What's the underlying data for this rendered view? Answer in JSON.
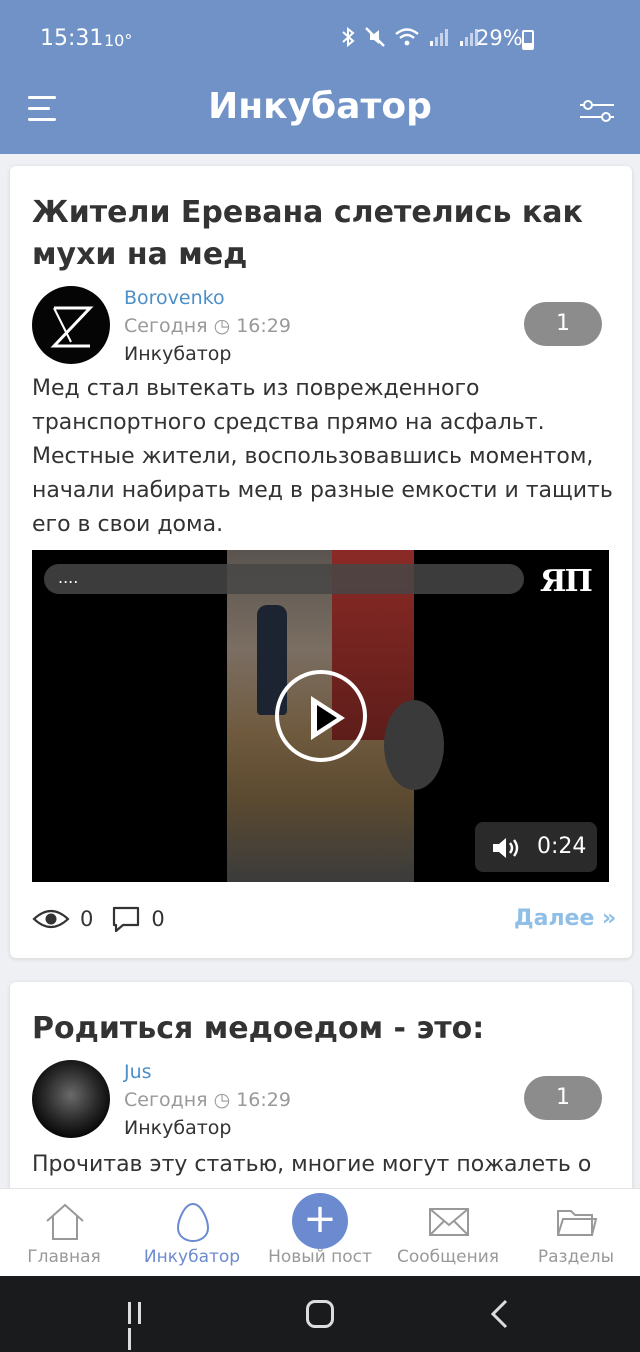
{
  "status_bar": {
    "time": "15:31",
    "temperature": "10°",
    "battery": "29%"
  },
  "header": {
    "title": "Инкубатор"
  },
  "posts": [
    {
      "title": "Жители Еревана слетелись как мухи на мед",
      "author": "Borovenko",
      "date": "Сегодня ◷ 16:29",
      "category": "Инкубатор",
      "rating": "1",
      "excerpt": "Мед стал вытекать из поврежденного транспортного средства прямо на асфальт. Местные жители, воспользовавшись моментом, начали набирать мед в разные емкости и тащить его в свои дома.",
      "video": {
        "url_text": "....",
        "logo": "ЯП",
        "duration": "0:24"
      },
      "views": "0",
      "comments": "0",
      "more_label": "Далее »"
    },
    {
      "title": "Родиться медоедом - это:",
      "author": "Jus",
      "date": "Сегодня ◷ 16:29",
      "category": "Инкубатор",
      "rating": "1",
      "excerpt": "Прочитав эту статью, многие могут пожалеть о"
    }
  ],
  "bottom_nav": [
    {
      "label": "Главная",
      "icon": "home-icon"
    },
    {
      "label": "Инкубатор",
      "icon": "egg-icon",
      "active": true
    },
    {
      "label": "Новый пост",
      "icon": "plus-icon"
    },
    {
      "label": "Сообщения",
      "icon": "envelope-icon"
    },
    {
      "label": "Разделы",
      "icon": "folder-icon"
    }
  ],
  "colors": {
    "header": "#7092c7",
    "accent": "#6b8ad0",
    "author_link": "#4d8fc8",
    "more_link": "#8fbfe6"
  }
}
